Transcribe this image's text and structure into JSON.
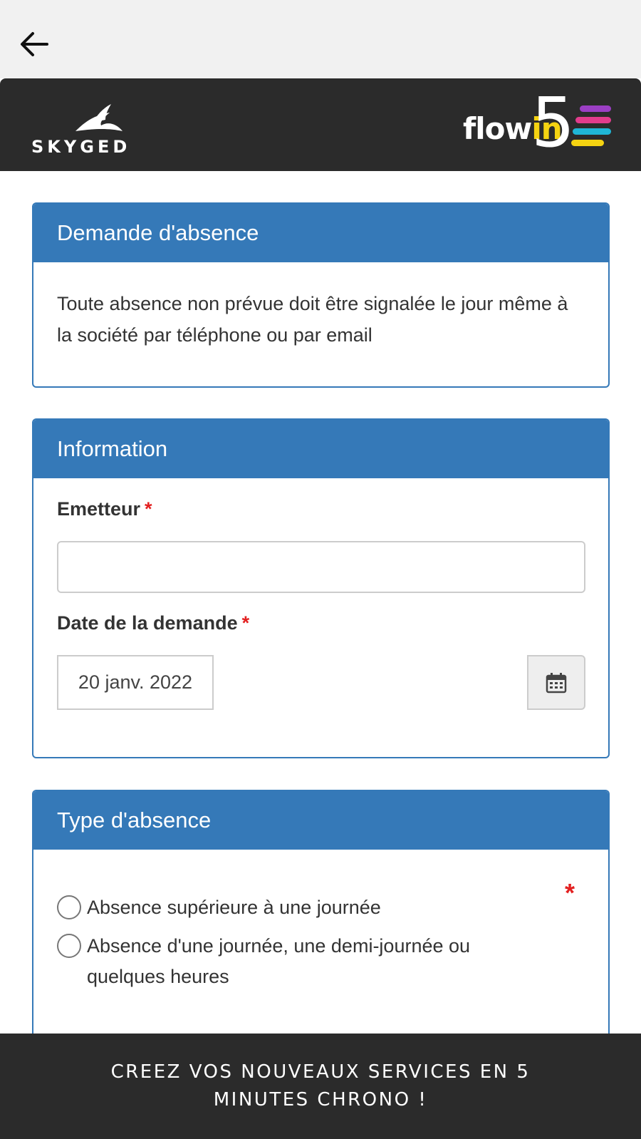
{
  "nav": {
    "back_icon": "arrow-left-icon"
  },
  "brand": {
    "left_logo": "SKYGED",
    "right_logo_prefix": "flow",
    "right_logo_highlight": "in",
    "right_logo_number": "5",
    "colors": {
      "bar_bg": "#2b2b2b",
      "flowin_yellow": "#f5d311",
      "stripe_purple": "#9b3fc4",
      "stripe_pink": "#e23c8c",
      "stripe_cyan": "#1fb6d6",
      "stripe_yellow": "#f5d311"
    }
  },
  "section_absence": {
    "title": "Demande d'absence",
    "notice": "Toute absence non prévue doit être signalée le jour même à la société par téléphone ou par email"
  },
  "section_info": {
    "title": "Information",
    "emitter_label": "Emetteur",
    "emitter_value": "",
    "required_mark": "*",
    "date_label": "Date de la demande",
    "date_value": "20 janv. 2022",
    "calendar_icon": "calendar-icon"
  },
  "section_type": {
    "title": "Type d'absence",
    "required_mark": "*",
    "options": [
      {
        "label": "Absence supérieure à une journée",
        "selected": false
      },
      {
        "label": "Absence d'une journée, une demi-journée ou quelques heures",
        "selected": false
      }
    ]
  },
  "footer": {
    "text": "CREEZ VOS NOUVEAUX SERVICES EN 5 MINUTES CHRONO !"
  },
  "theme": {
    "panel_blue": "#3579b8",
    "required_red": "#e32020"
  }
}
